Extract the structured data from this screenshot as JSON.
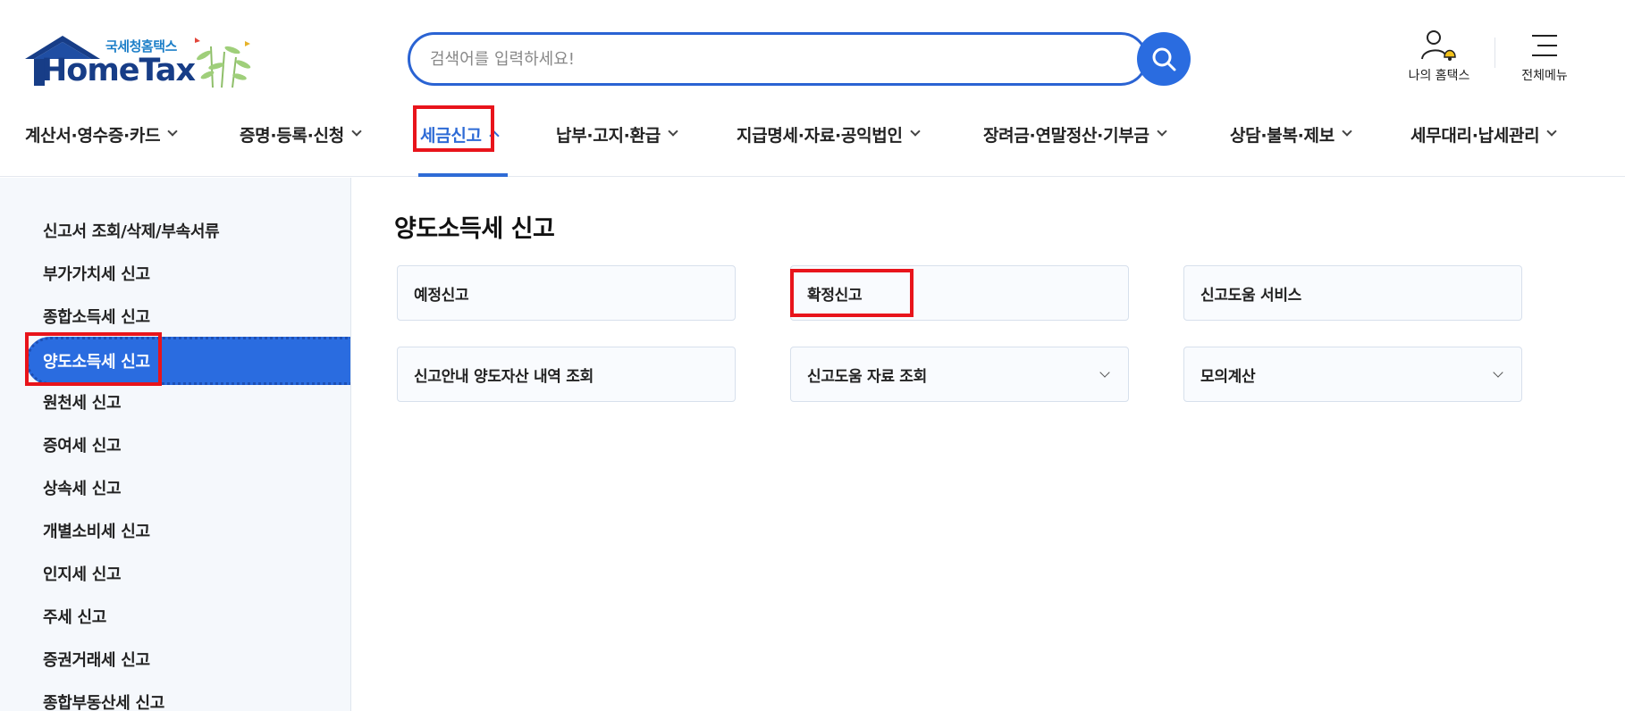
{
  "header": {
    "logo": {
      "sub": "국세청홈택스",
      "main": "HomeTax"
    },
    "search": {
      "placeholder": "검색어를 입력하세요!"
    },
    "utility": {
      "my_hometax": "나의 홈택스",
      "all_menu": "전체메뉴"
    }
  },
  "gnb": {
    "items": [
      {
        "label": "계산서·영수증·카드"
      },
      {
        "label": "증명·등록·신청"
      },
      {
        "label": "세금신고"
      },
      {
        "label": "납부·고지·환급"
      },
      {
        "label": "지급명세·자료·공익법인"
      },
      {
        "label": "장려금·연말정산·기부금"
      },
      {
        "label": "상담·불복·제보"
      },
      {
        "label": "세무대리·납세관리"
      }
    ],
    "active_index": 2
  },
  "sidebar": {
    "items": [
      {
        "label": "신고서 조회/삭제/부속서류"
      },
      {
        "label": "부가가치세 신고"
      },
      {
        "label": "종합소득세 신고"
      },
      {
        "label": "양도소득세 신고"
      },
      {
        "label": "원천세 신고"
      },
      {
        "label": "증여세 신고"
      },
      {
        "label": "상속세 신고"
      },
      {
        "label": "개별소비세 신고"
      },
      {
        "label": "인지세 신고"
      },
      {
        "label": "주세 신고"
      },
      {
        "label": "증권거래세 신고"
      },
      {
        "label": "종합부동산세 신고"
      }
    ],
    "active_index": 3
  },
  "main": {
    "title": "양도소득세 신고",
    "cards": [
      {
        "label": "예정신고"
      },
      {
        "label": "확정신고"
      },
      {
        "label": "신고도움 서비스"
      },
      {
        "label": "신고안내 양도자산 내역 조회"
      },
      {
        "label": "신고도움 자료 조회"
      },
      {
        "label": "모의계산"
      }
    ]
  },
  "colors": {
    "accent": "#2a6ce0",
    "highlight": "#e8141b",
    "logo_navy": "#173d87"
  }
}
